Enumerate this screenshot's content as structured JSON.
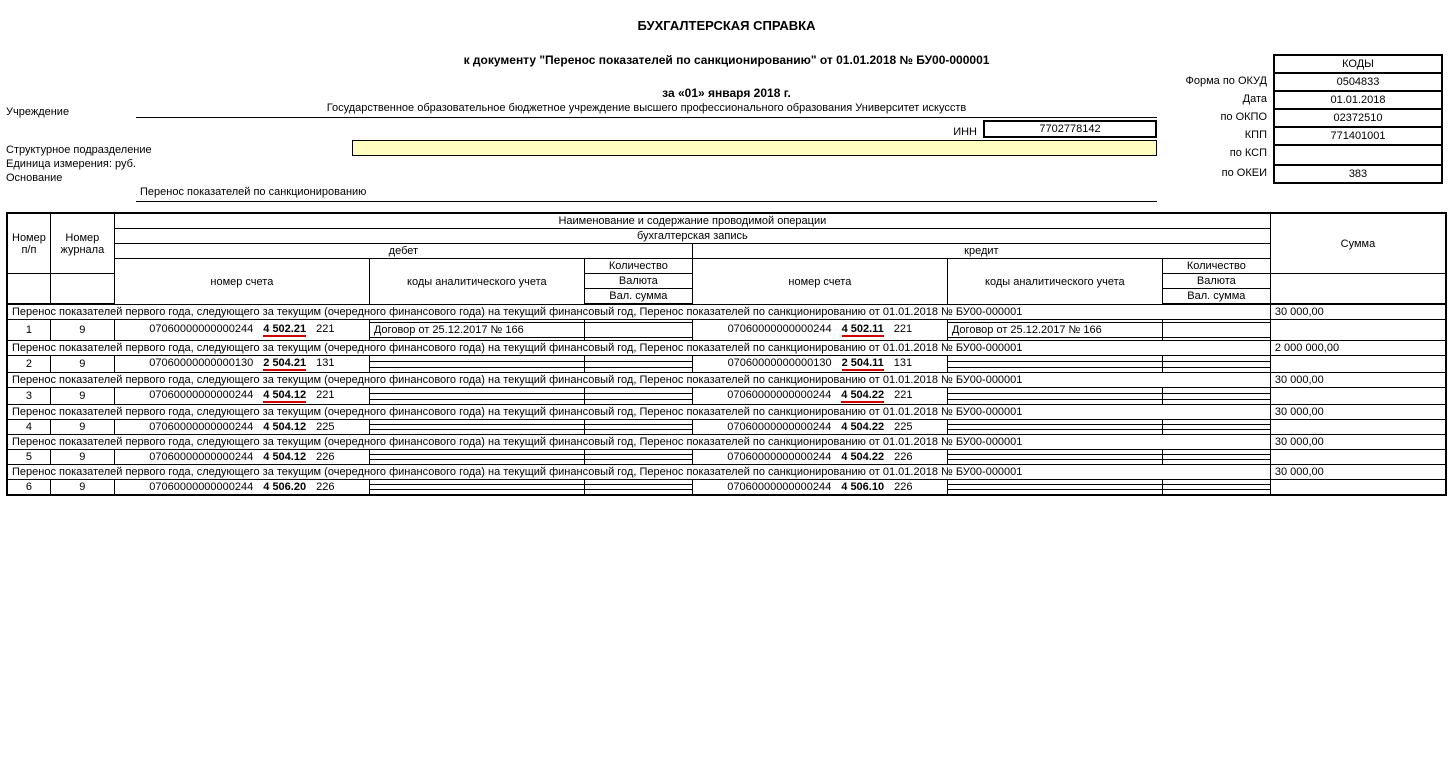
{
  "title": "БУХГАЛТЕРСКАЯ СПРАВКА",
  "subtitle": "к документу \"Перенос показателей по санкционированию\" от 01.01.2018 № БУ00-000001",
  "period": "за «01» января 2018 г.",
  "labels": {
    "org": "Учреждение",
    "struct": "Структурное подразделение",
    "unit": "Единица измерения: руб.",
    "basis": "Основание",
    "inn": "ИНН",
    "codes": "КОДЫ",
    "byOKUD": "Форма  по ОКУД",
    "date": "Дата",
    "byOKPO": "по ОКПО",
    "kpp": "КПП",
    "byKSP": "по КСП",
    "byOKEI": "по ОКЕИ"
  },
  "org": "Государственное образовательное бюджетное учреждение высшего профессионального образования Университет искусств",
  "basis": "Перенос показателей по санкционированию",
  "inn": "7702778142",
  "codes": {
    "okud": "0504833",
    "date": "01.01.2018",
    "okpo": "02372510",
    "kpp": "771401001",
    "ksp": "",
    "okei": "383"
  },
  "headers": {
    "num": "Номер п/п",
    "journal": "Номер журнала",
    "opName": "Наименование и содержание проводимой операции",
    "entry": "бухгалтерская запись",
    "debit": "дебет",
    "credit": "кредит",
    "account": "номер счета",
    "analytics": "коды аналитического учета",
    "qty": "Количество",
    "currency": "Валюта",
    "valSum": "Вал. сумма",
    "sum": "Сумма"
  },
  "opText": "Перенос показателей первого года, следующего за текущим (очередного финансового года) на текущий финансовый год, Перенос показателей по санкционированию от 01.01.2018 № БУ00-000001",
  "rows": [
    {
      "n": "1",
      "j": "9",
      "dAcc": "07060000000000244",
      "dCorr": "4 502.21",
      "dSuf": "221",
      "dHl": true,
      "dAn": "Договор от 25.12.2017 № 166",
      "cAcc": "07060000000000244",
      "cCorr": "4 502.11",
      "cSuf": "221",
      "cHl": true,
      "cAn": "Договор от 25.12.2017 № 166",
      "sum": "30 000,00"
    },
    {
      "n": "2",
      "j": "9",
      "dAcc": "07060000000000130",
      "dCorr": "2 504.21",
      "dSuf": "131",
      "dHl": true,
      "dAn": "",
      "cAcc": "07060000000000130",
      "cCorr": "2 504.11",
      "cSuf": "131",
      "cHl": true,
      "cAn": "",
      "sum": "2 000 000,00"
    },
    {
      "n": "3",
      "j": "9",
      "dAcc": "07060000000000244",
      "dCorr": "4 504.12",
      "dSuf": "221",
      "dHl": true,
      "dAn": "",
      "cAcc": "07060000000000244",
      "cCorr": "4 504.22",
      "cSuf": "221",
      "cHl": true,
      "cAn": "",
      "sum": "30 000,00"
    },
    {
      "n": "4",
      "j": "9",
      "dAcc": "07060000000000244",
      "dCorr": "4 504.12",
      "dSuf": "225",
      "dHl": false,
      "dAn": "",
      "cAcc": "07060000000000244",
      "cCorr": "4 504.22",
      "cSuf": "225",
      "cHl": false,
      "cAn": "",
      "sum": "30 000,00"
    },
    {
      "n": "5",
      "j": "9",
      "dAcc": "07060000000000244",
      "dCorr": "4 504.12",
      "dSuf": "226",
      "dHl": false,
      "dAn": "",
      "cAcc": "07060000000000244",
      "cCorr": "4 504.22",
      "cSuf": "226",
      "cHl": false,
      "cAn": "",
      "sum": "30 000,00"
    },
    {
      "n": "6",
      "j": "9",
      "dAcc": "07060000000000244",
      "dCorr": "4 506.20",
      "dSuf": "226",
      "dHl": false,
      "dAn": "",
      "cAcc": "07060000000000244",
      "cCorr": "4 506.10",
      "cSuf": "226",
      "cHl": false,
      "cAn": "",
      "sum": "30 000,00"
    }
  ]
}
